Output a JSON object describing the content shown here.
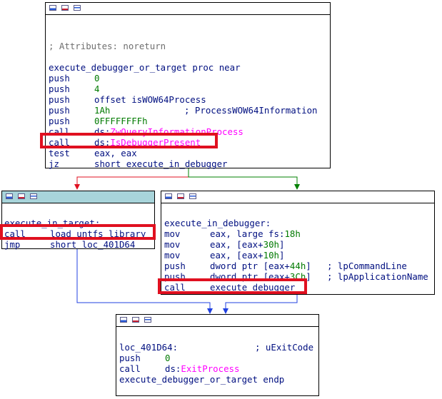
{
  "node_top": {
    "comment": "; Attributes: noreturn",
    "lines": [
      {
        "a": "execute_debugger_or_target proc near"
      },
      {
        "a": "push",
        "b": "0"
      },
      {
        "a": "push",
        "b": "4"
      },
      {
        "a": "push",
        "b": "offset isWOW64Process"
      },
      {
        "a": "push",
        "b": "1Ah",
        "c": "; ProcessWOW64Information"
      },
      {
        "a": "push",
        "b": "0FFFFFFFFh"
      },
      {
        "a": "call",
        "b": "ds:",
        "b2": "ZwQueryInformationProcess"
      },
      {
        "a": "call",
        "b": "ds:",
        "b2": "IsDebuggerPresent"
      },
      {
        "a": "test",
        "b": "eax, eax"
      },
      {
        "a": "jz",
        "b": "short execute_in_debugger"
      }
    ]
  },
  "node_left": {
    "lines": [
      {
        "a": "execute_in_target:"
      },
      {
        "a": "call",
        "b": "load_untfs_library"
      },
      {
        "a": "jmp",
        "b": "short loc_401D64"
      }
    ]
  },
  "node_right": {
    "lines": [
      {
        "a": "execute_in_debugger:"
      },
      {
        "a": "mov",
        "b": "eax, large fs:",
        "b2": "18h"
      },
      {
        "a": "mov",
        "b": "eax, [eax+",
        "b2": "30h",
        "b3": "]"
      },
      {
        "a": "mov",
        "b": "eax, [eax+",
        "b2": "10h",
        "b3": "]"
      },
      {
        "a": "push",
        "b": "dword ptr [eax+",
        "b2": "44h",
        "b3": "]",
        "c": "; lpCommandLine"
      },
      {
        "a": "push",
        "b": "dword ptr [eax+",
        "b2": "3Ch",
        "b3": "]",
        "c": "; lpApplicationName"
      },
      {
        "a": "call",
        "b": "execute_debugger"
      }
    ]
  },
  "node_bottom": {
    "lines": [
      {
        "a": "loc_401D64:",
        "c": "; uExitCode"
      },
      {
        "a": "push",
        "b": "0"
      },
      {
        "a": "call",
        "b": "ds:",
        "b2": "ExitProcess"
      },
      {
        "a": "execute_debugger_or_target endp"
      }
    ]
  },
  "colors": {
    "highlight": "#e01020",
    "edge_true": "#008000",
    "edge_false": "#e01020",
    "edge_uncond": "#2040e0"
  }
}
